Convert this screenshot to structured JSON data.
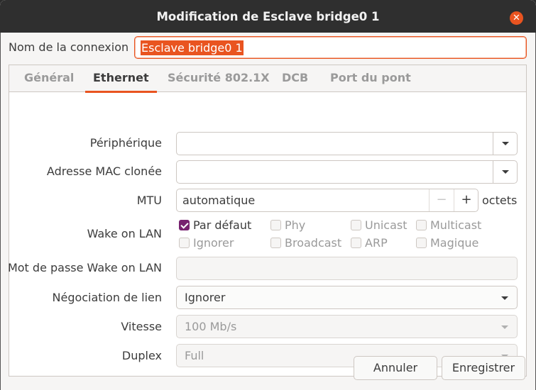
{
  "window": {
    "title": "Modification de Esclave bridge0 1"
  },
  "connection": {
    "label": "Nom de la connexion",
    "value": "Esclave bridge0 1"
  },
  "tabs": [
    {
      "label": "Général",
      "active": false
    },
    {
      "label": "Ethernet",
      "active": true
    },
    {
      "label": "Sécurité 802.1X",
      "active": false
    },
    {
      "label": "DCB",
      "active": false
    },
    {
      "label": "Port du pont",
      "active": false
    }
  ],
  "ethernet": {
    "device_label": "Périphérique",
    "device_value": "",
    "mac_label": "Adresse MAC clonée",
    "mac_value": "",
    "mtu_label": "MTU",
    "mtu_value": "automatique",
    "mtu_unit": "octets",
    "mtu_minus": "−",
    "mtu_plus": "+",
    "wol_label": "Wake on LAN",
    "wol_options": [
      {
        "label": "Par défaut",
        "checked": true
      },
      {
        "label": "Phy",
        "checked": false
      },
      {
        "label": "Unicast",
        "checked": false
      },
      {
        "label": "Multicast",
        "checked": false
      },
      {
        "label": "Ignorer",
        "checked": false
      },
      {
        "label": "Broadcast",
        "checked": false
      },
      {
        "label": "ARP",
        "checked": false
      },
      {
        "label": "Magique",
        "checked": false
      }
    ],
    "wol_password_label": "Mot de passe Wake on LAN",
    "wol_password_value": "",
    "negotiation_label": "Négociation de lien",
    "negotiation_value": "Ignorer",
    "speed_label": "Vitesse",
    "speed_value": "100 Mb/s",
    "duplex_label": "Duplex",
    "duplex_value": "Full"
  },
  "buttons": {
    "cancel": "Annuler",
    "save": "Enregistrer"
  },
  "colors": {
    "accent": "#e95420",
    "checkbox": "#77216f",
    "titlebar": "#2f2f2f"
  }
}
